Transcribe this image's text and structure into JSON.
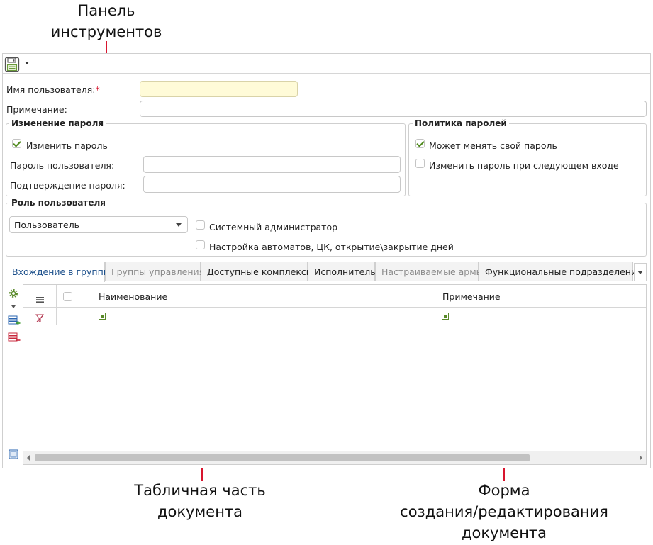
{
  "callouts": {
    "toolbar": [
      "Панель",
      "инструментов"
    ],
    "table": [
      "Табличная часть",
      "документа"
    ],
    "form": [
      "Форма",
      "создания/редактирования",
      "документа"
    ]
  },
  "form": {
    "username_label": "Имя пользователя:",
    "required_mark": "*",
    "username_value": "",
    "note_label": "Примечание:",
    "note_value": ""
  },
  "password_change": {
    "title": "Изменение пароля",
    "change_label": "Изменить пароль",
    "change_checked": true,
    "password_label": "Пароль пользователя:",
    "password_value": "",
    "confirm_label": "Подтверждение пароля:",
    "confirm_value": ""
  },
  "password_policy": {
    "title": "Политика паролей",
    "can_change_label": "Может менять свой пароль",
    "can_change_checked": true,
    "next_login_label": "Изменить пароль при следующем входе",
    "next_login_checked": false
  },
  "role": {
    "title": "Роль пользователя",
    "selected": "Пользователь",
    "sysadmin_label": "Системный администратор",
    "automata_label": "Настройка автоматов, ЦК, открытие\\закрытие дней"
  },
  "tabs": [
    {
      "label": "Вхождение в группы",
      "state": "active"
    },
    {
      "label": "Группы управления",
      "state": "disabled"
    },
    {
      "label": "Доступные комплексы",
      "state": "normal"
    },
    {
      "label": "Исполнитель",
      "state": "normal"
    },
    {
      "label": "Настраиваемые армы",
      "state": "disabled"
    },
    {
      "label": "Функциональные подразделения",
      "state": "normal"
    }
  ],
  "grid": {
    "columns": [
      "Наименование",
      "Примечание"
    ],
    "rows": []
  },
  "colors": {
    "accent_red": "#d8152e",
    "active_tab_text": "#1a4e8a",
    "required_field_bg": "#fffbd8"
  }
}
